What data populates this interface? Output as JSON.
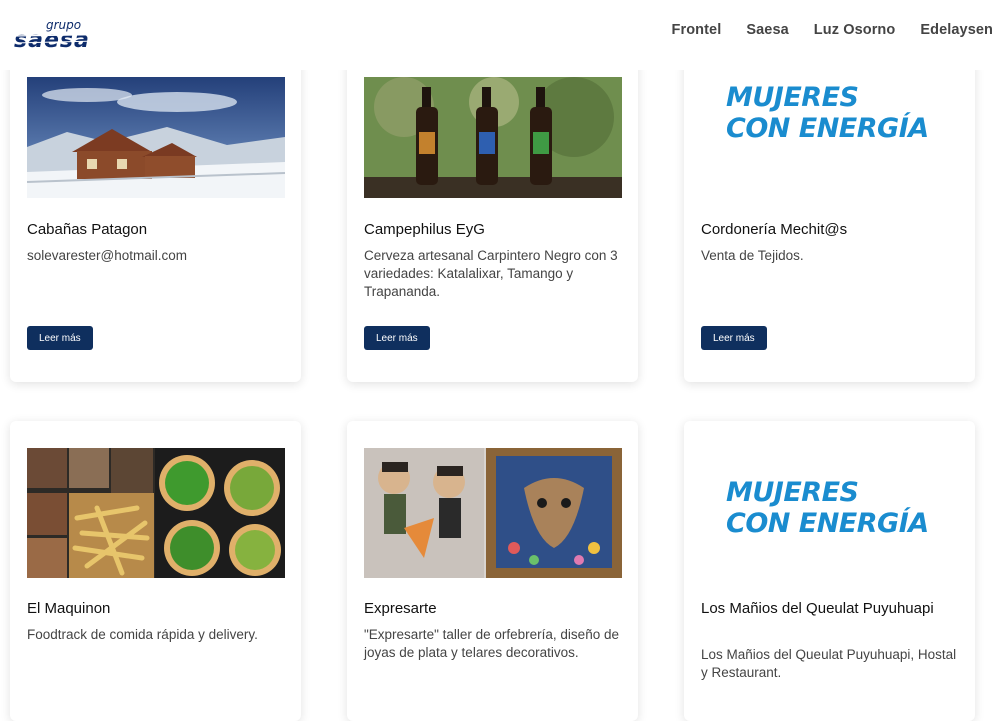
{
  "header": {
    "logo": {
      "top_text": "grupo",
      "main_text": "saesa"
    },
    "nav": [
      "Frontel",
      "Saesa",
      "Luz Osorno",
      "Edelaysen"
    ]
  },
  "colors": {
    "button_bg": "#0f2f5e",
    "brand_blue": "#1a8ccf"
  },
  "cards": [
    {
      "title": "Cabañas Patagon",
      "desc": "solevarester@hotmail.com",
      "button": "Leer más",
      "image": "cabin-snow-photo"
    },
    {
      "title": "Campephilus EyG",
      "desc": "Cerveza artesanal Carpintero Negro con 3 variedades: Katalalixar, Tamango y Trapananda.",
      "button": "Leer más",
      "image": "beer-bottles-photo"
    },
    {
      "title": "Cordonería Mechit@s",
      "desc": "Venta de Tejidos.",
      "button": "Leer más",
      "image": "mujeres-con-energia-logo",
      "logo_line1": "MUJERES",
      "logo_line2": "CON ENERGÍA"
    },
    {
      "title": "El Maquinon",
      "desc": "Foodtrack de comida rápida y delivery.",
      "image": "food-collage-photo"
    },
    {
      "title": "Expresarte",
      "desc": "\"Expresarte\" taller de orfebrería, diseño de joyas de plata y telares decorativos.",
      "image": "crafts-photo"
    },
    {
      "title": "Los Mañios del Queulat Puyuhuapi",
      "desc": "Los Mañios del Queulat Puyuhuapi, Hostal y Restaurant.",
      "image": "mujeres-con-energia-logo",
      "logo_line1": "MUJERES",
      "logo_line2": "CON ENERGÍA"
    }
  ]
}
